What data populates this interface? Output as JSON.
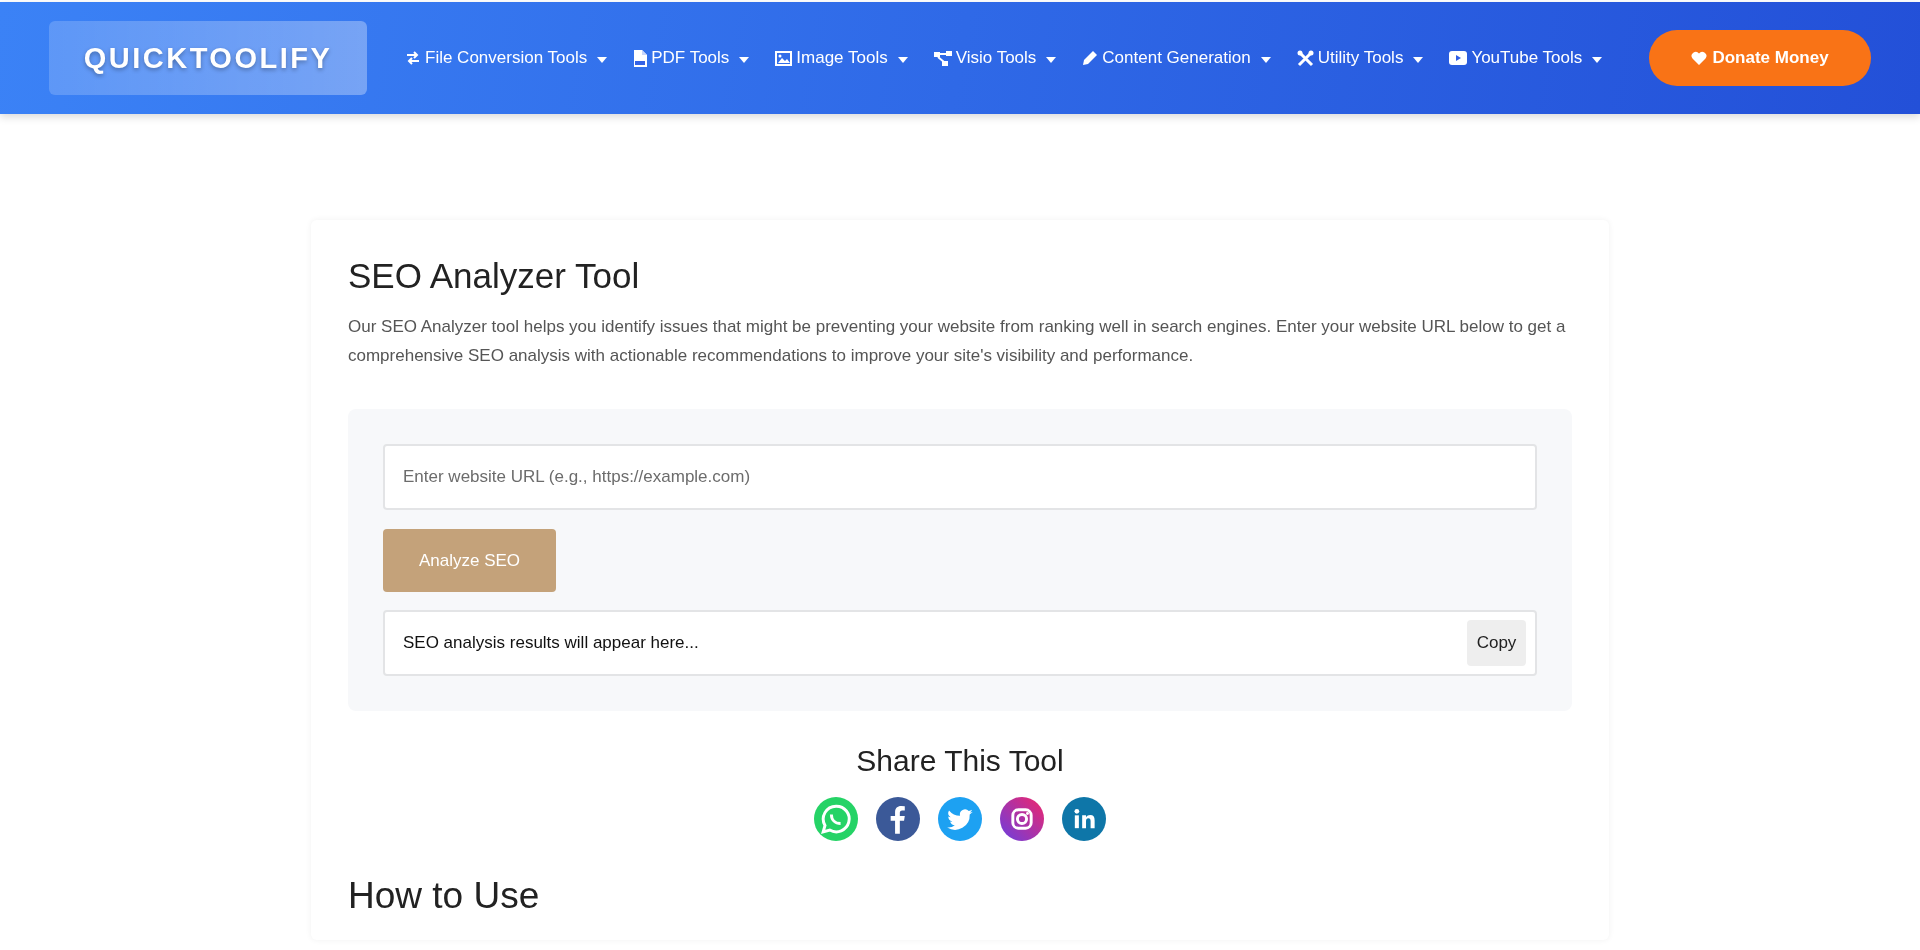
{
  "header": {
    "logo": "QUICKTOOLIFY",
    "nav": [
      {
        "label": "File Conversion Tools",
        "kind": "arrows"
      },
      {
        "label": "PDF Tools",
        "kind": "pdf"
      },
      {
        "label": "Image Tools",
        "kind": "image"
      },
      {
        "label": "Visio Tools",
        "kind": "sitemap"
      },
      {
        "label": "Content Generation",
        "kind": "pencil"
      },
      {
        "label": "Utility Tools",
        "kind": "tools"
      },
      {
        "label": "YouTube Tools",
        "kind": "youtube"
      }
    ],
    "donate": "Donate Money"
  },
  "tool": {
    "title": "SEO Analyzer Tool",
    "description": "Our SEO Analyzer tool helps you identify issues that might be preventing your website from ranking well in search engines. Enter your website URL below to get a comprehensive SEO analysis with actionable recommendations to improve your site's visibility and performance.",
    "url_field": {
      "placeholder": "Enter website URL (e.g., https://example.com)"
    },
    "analyze_button": "Analyze SEO",
    "result": "SEO analysis results will appear here...",
    "copy_button": "Copy"
  },
  "share": {
    "title": "Share This Tool",
    "networks": [
      {
        "kind": "whatsapp"
      },
      {
        "kind": "facebook"
      },
      {
        "kind": "twitter"
      },
      {
        "kind": "instagram"
      },
      {
        "kind": "linkedin"
      }
    ]
  },
  "how_to": {
    "title": "How to Use"
  }
}
